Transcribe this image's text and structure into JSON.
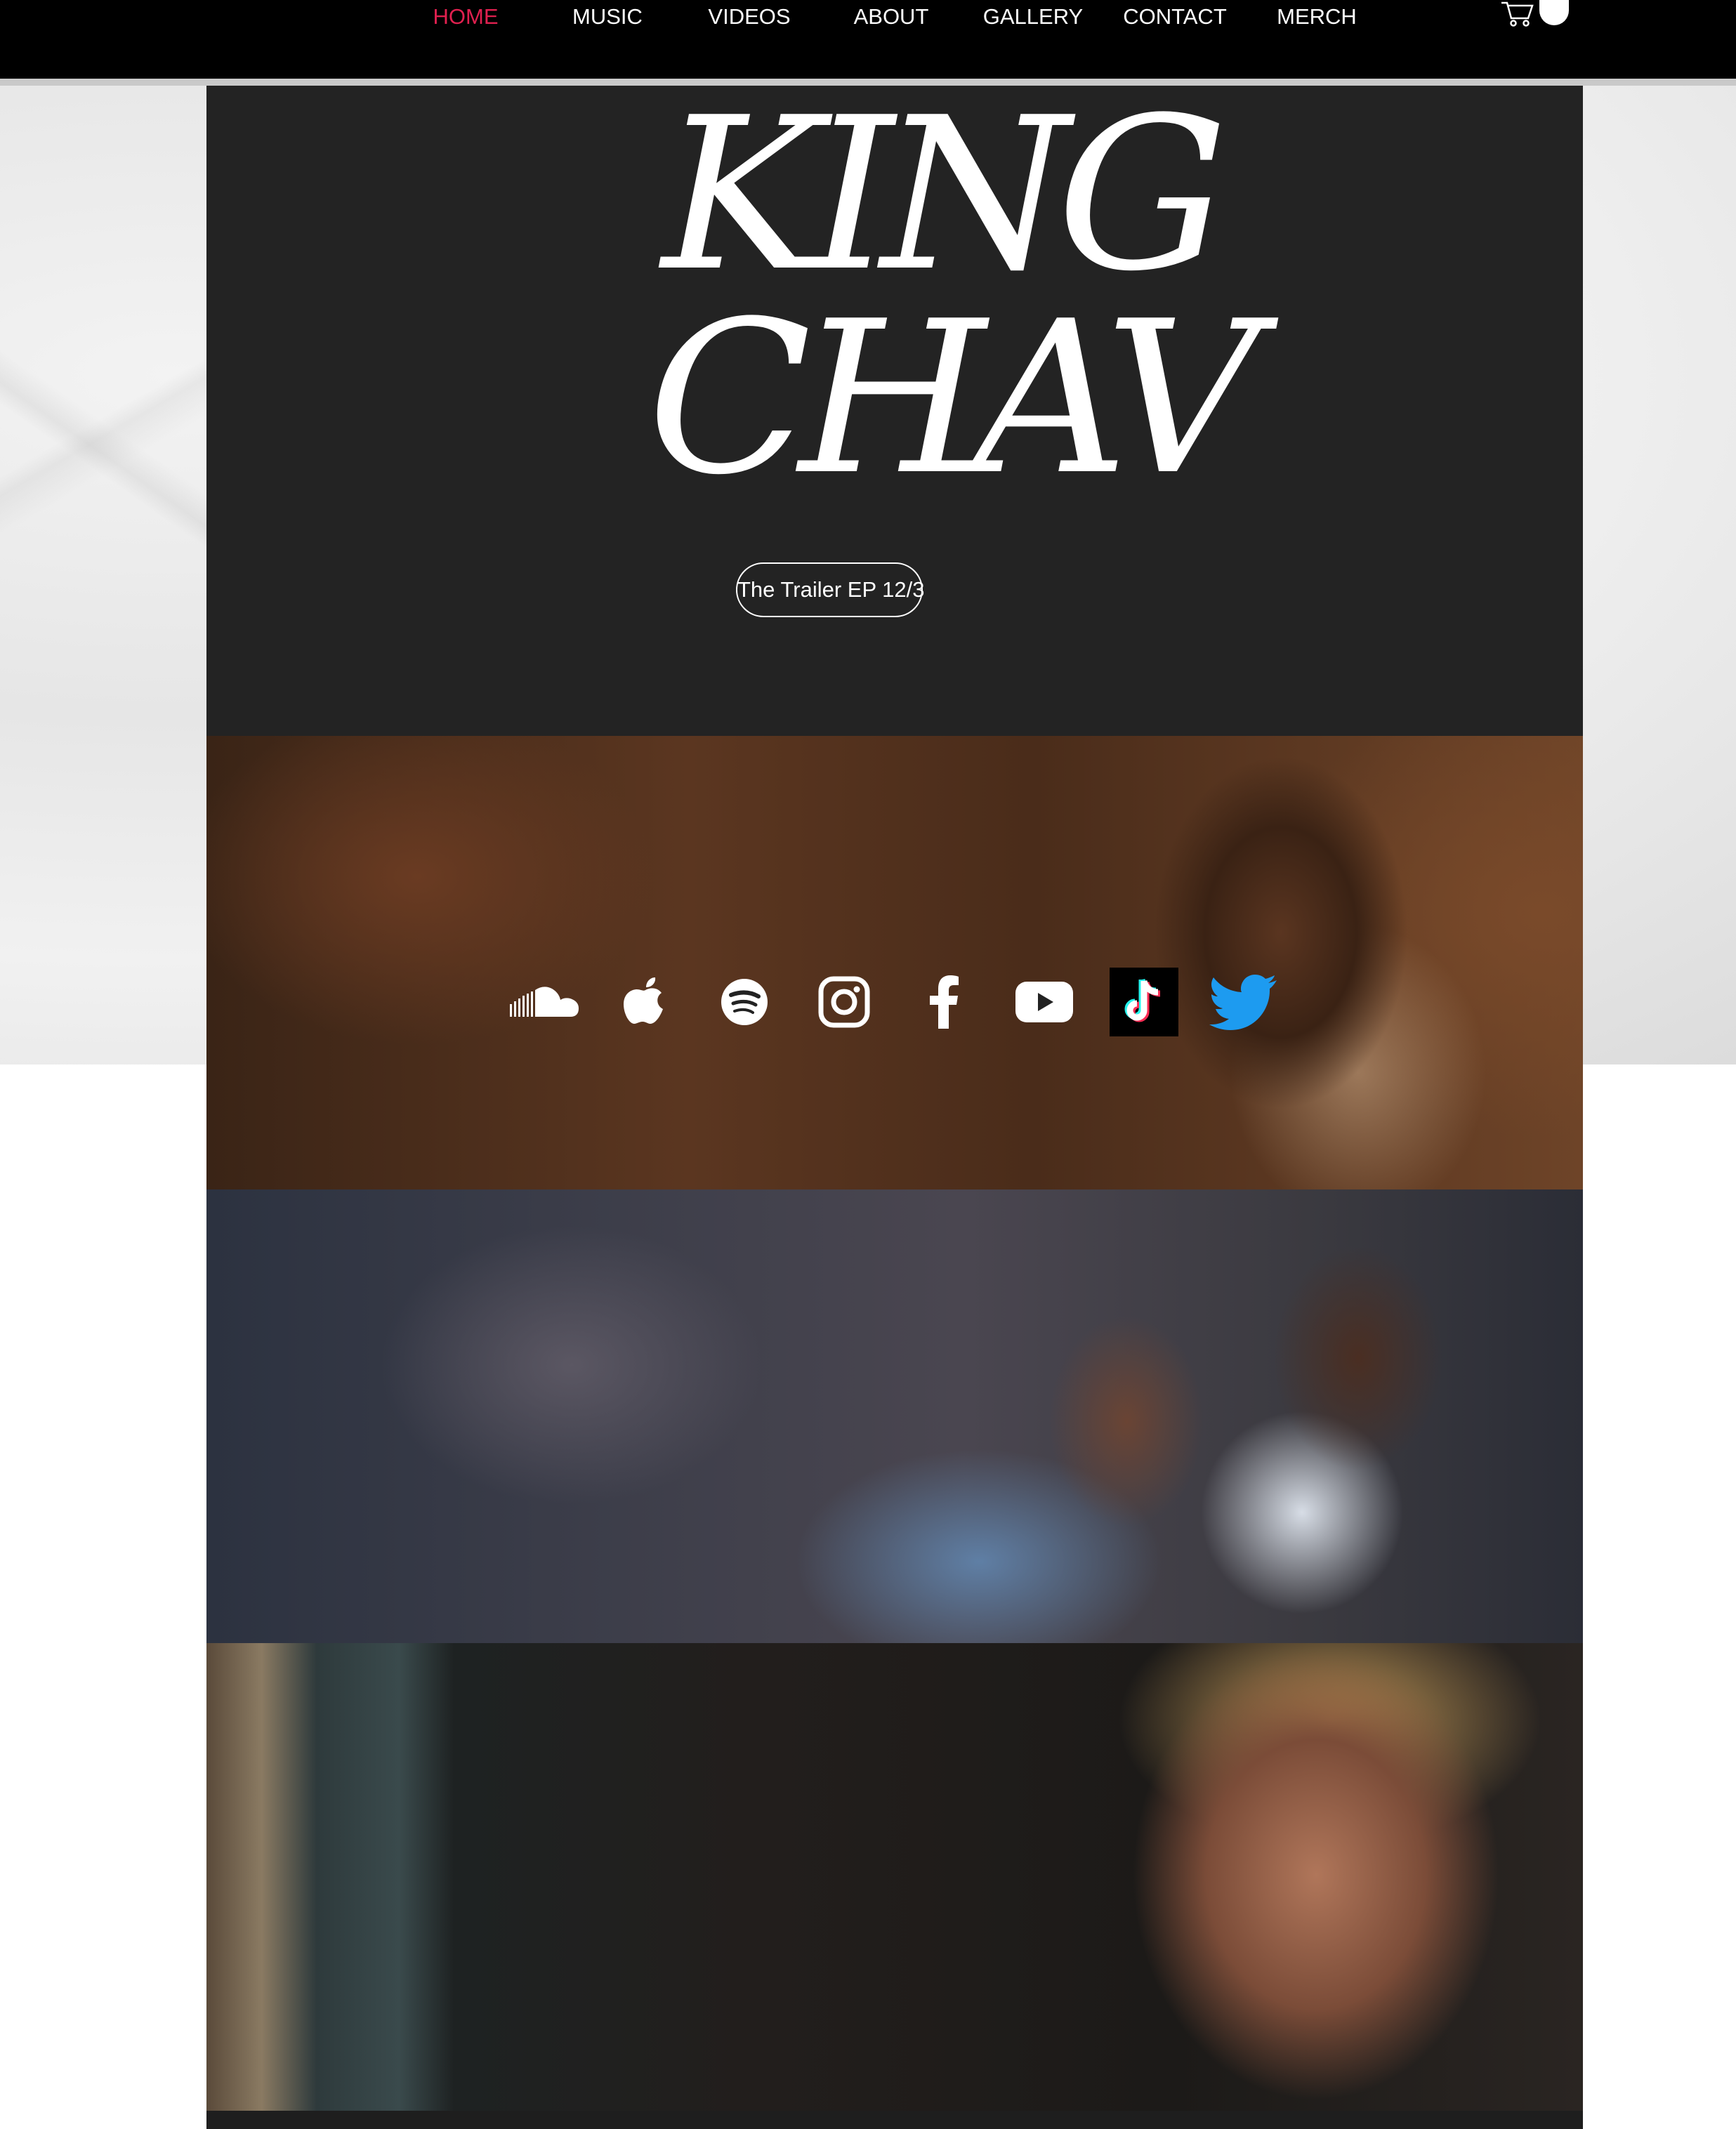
{
  "nav": {
    "items": [
      {
        "label": "HOME",
        "active": true
      },
      {
        "label": "MUSIC",
        "active": false
      },
      {
        "label": "VIDEOS",
        "active": false
      },
      {
        "label": "ABOUT",
        "active": false
      },
      {
        "label": "GALLERY",
        "active": false
      },
      {
        "label": "CONTACT",
        "active": false
      },
      {
        "label": "MERCH",
        "active": false
      }
    ],
    "cart_icon": "cart-icon"
  },
  "hero": {
    "title_line1": "KING",
    "title_line2": "CHAV",
    "trailer_button": "The Trailer EP 12/3"
  },
  "social": [
    {
      "icon": "soundcloud-icon"
    },
    {
      "icon": "apple-music-icon"
    },
    {
      "icon": "spotify-icon"
    },
    {
      "icon": "instagram-icon"
    },
    {
      "icon": "facebook-icon"
    },
    {
      "icon": "youtube-icon"
    },
    {
      "icon": "tiktok-icon"
    },
    {
      "icon": "twitter-icon"
    }
  ],
  "colors": {
    "nav_background": "#000000",
    "nav_active": "#e0204f",
    "nav_text": "#ffffff",
    "hero_background": "#232323",
    "twitter_blue": "#1d9bf0"
  }
}
